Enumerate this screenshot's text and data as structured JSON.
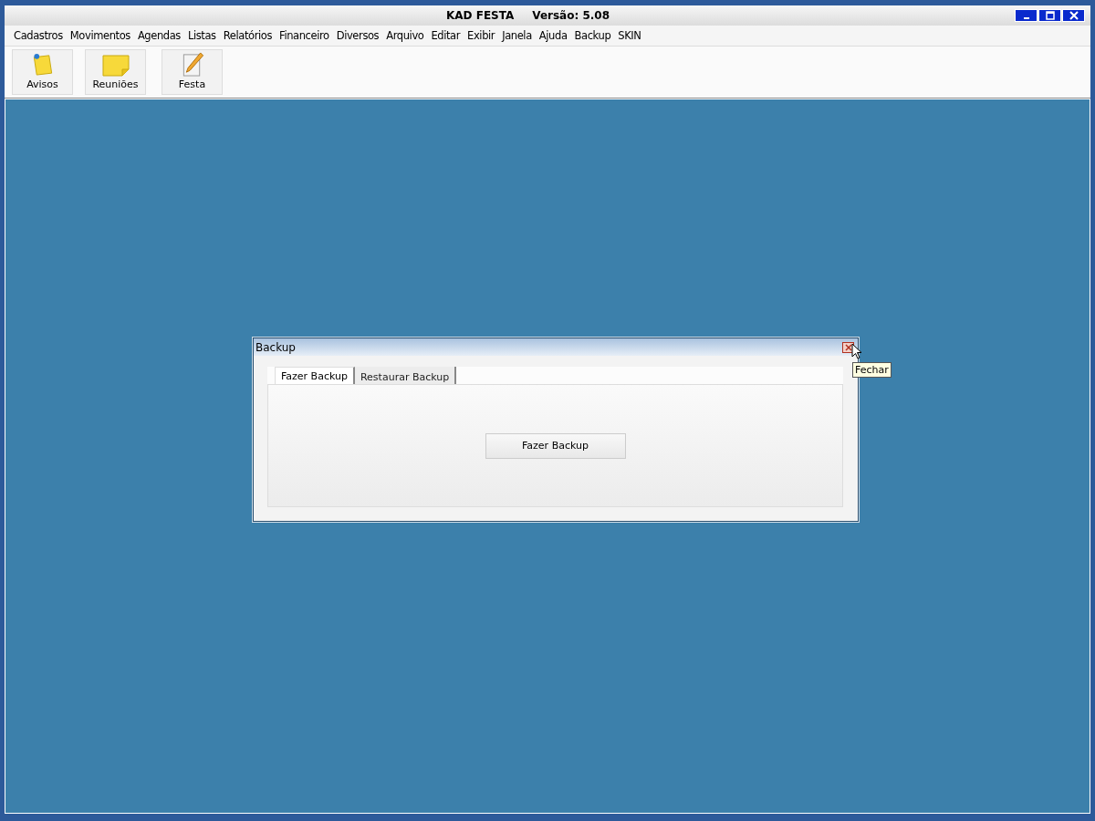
{
  "window": {
    "title": "KAD FESTA",
    "version": "Versão: 5.08"
  },
  "menu": [
    "Cadastros",
    "Movimentos",
    "Agendas",
    "Listas",
    "Relatórios",
    "Financeiro",
    "Diversos",
    "Arquivo",
    "Editar",
    "Exibir",
    "Janela",
    "Ajuda",
    "Backup",
    "SKIN"
  ],
  "toolbar": [
    {
      "label": "Avisos",
      "kind": "pinned-note"
    },
    {
      "label": "Reuniões",
      "kind": "note"
    },
    {
      "label": "Festa",
      "kind": "pencil"
    }
  ],
  "dialog": {
    "title": "Backup",
    "tooltip": "Fechar",
    "tabs": [
      {
        "label": "Fazer Backup",
        "selected": true
      },
      {
        "label": "Restaurar Backup",
        "selected": false
      }
    ],
    "button": "Fazer Backup"
  }
}
